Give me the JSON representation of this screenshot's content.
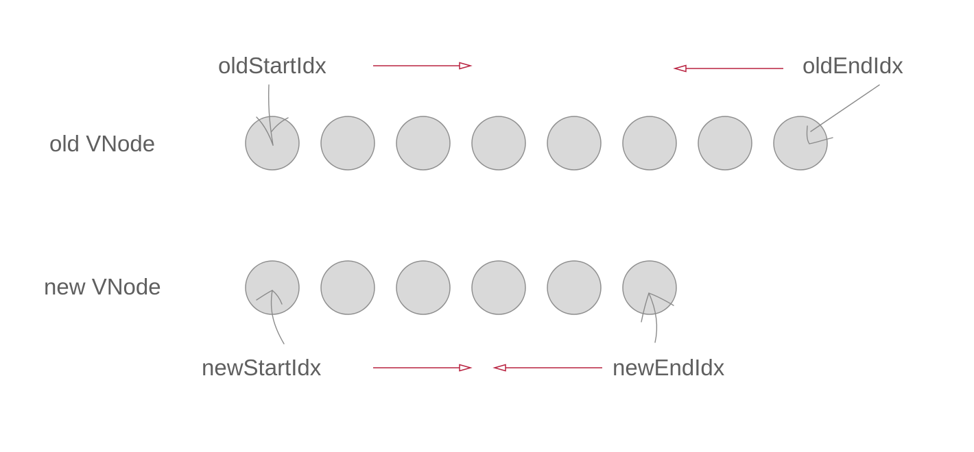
{
  "labels": {
    "old_vnode": "old VNode",
    "new_vnode": "new VNode",
    "old_start_idx": "oldStartIdx",
    "old_end_idx": "oldEndIdx",
    "new_start_idx": "newStartIdx",
    "new_end_idx": "newEndIdx"
  },
  "old_vnode_count": 8,
  "new_vnode_count": 6,
  "colors": {
    "node_fill": "#d9d9d9",
    "node_stroke": "#8e8e8e",
    "text": "#5f5f5f",
    "arrow": "#b8203f",
    "pointer": "#8a8a8a"
  }
}
